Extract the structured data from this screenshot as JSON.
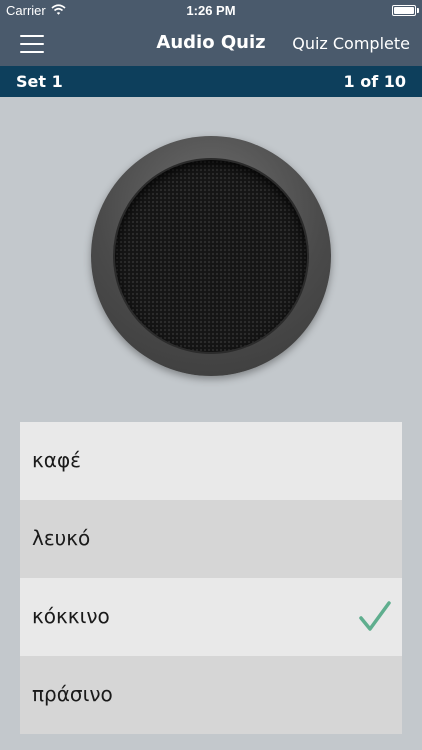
{
  "status_bar": {
    "carrier": "Carrier",
    "time": "1:26 PM",
    "wifi_icon": "wifi-icon",
    "battery_icon": "battery-icon",
    "battery_level": 1.0
  },
  "nav": {
    "menu_icon": "hamburger-menu-icon",
    "title": "Audio Quiz",
    "action": "Quiz Complete"
  },
  "set_bar": {
    "set_label": "Set 1",
    "progress": "1 of 10"
  },
  "speaker": {
    "icon": "speaker-icon"
  },
  "answers": [
    {
      "text": "καφέ",
      "selected": false
    },
    {
      "text": "λευκό",
      "selected": false
    },
    {
      "text": "κόκκινο",
      "selected": true
    },
    {
      "text": "πράσινο",
      "selected": false
    }
  ],
  "colors": {
    "nav_background": "#4a5a6c",
    "set_bar_background": "#0d3f5c",
    "page_background": "#c3c8cc",
    "check_color": "#5fae8e"
  }
}
